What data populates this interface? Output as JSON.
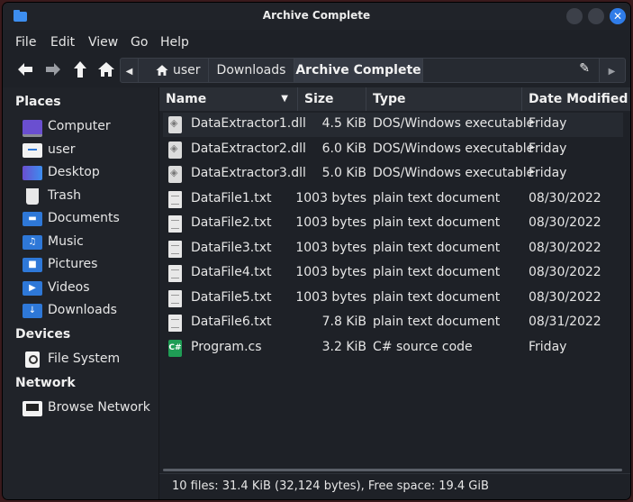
{
  "window": {
    "title": "Archive Complete"
  },
  "menu": [
    "File",
    "Edit",
    "View",
    "Go",
    "Help"
  ],
  "pathbar": {
    "crumbs": [
      "user",
      "Downloads",
      "Archive Complete"
    ]
  },
  "sidebar": {
    "places_title": "Places",
    "places": [
      {
        "label": "Computer",
        "icon": "computer-icon"
      },
      {
        "label": "user",
        "icon": "home-folder-icon"
      },
      {
        "label": "Desktop",
        "icon": "desktop-icon"
      },
      {
        "label": "Trash",
        "icon": "trash-icon"
      },
      {
        "label": "Documents",
        "icon": "documents-folder-icon"
      },
      {
        "label": "Music",
        "icon": "music-folder-icon"
      },
      {
        "label": "Pictures",
        "icon": "pictures-folder-icon"
      },
      {
        "label": "Videos",
        "icon": "videos-folder-icon"
      },
      {
        "label": "Downloads",
        "icon": "downloads-folder-icon"
      }
    ],
    "devices_title": "Devices",
    "devices": [
      {
        "label": "File System",
        "icon": "drive-icon"
      }
    ],
    "network_title": "Network",
    "network": [
      {
        "label": "Browse Network",
        "icon": "network-icon"
      }
    ]
  },
  "columns": {
    "name": "Name",
    "size": "Size",
    "type": "Type",
    "date": "Date Modified"
  },
  "files": [
    {
      "name": "DataExtractor1.dll",
      "size": "4.5 KiB",
      "type": "DOS/Windows executable",
      "date": "Friday",
      "kind": "dll"
    },
    {
      "name": "DataExtractor2.dll",
      "size": "6.0 KiB",
      "type": "DOS/Windows executable",
      "date": "Friday",
      "kind": "dll"
    },
    {
      "name": "DataExtractor3.dll",
      "size": "5.0 KiB",
      "type": "DOS/Windows executable",
      "date": "Friday",
      "kind": "dll"
    },
    {
      "name": "DataFile1.txt",
      "size": "1003 bytes",
      "type": "plain text document",
      "date": "08/30/2022",
      "kind": "txt"
    },
    {
      "name": "DataFile2.txt",
      "size": "1003 bytes",
      "type": "plain text document",
      "date": "08/30/2022",
      "kind": "txt"
    },
    {
      "name": "DataFile3.txt",
      "size": "1003 bytes",
      "type": "plain text document",
      "date": "08/30/2022",
      "kind": "txt"
    },
    {
      "name": "DataFile4.txt",
      "size": "1003 bytes",
      "type": "plain text document",
      "date": "08/30/2022",
      "kind": "txt"
    },
    {
      "name": "DataFile5.txt",
      "size": "1003 bytes",
      "type": "plain text document",
      "date": "08/30/2022",
      "kind": "txt"
    },
    {
      "name": "DataFile6.txt",
      "size": "7.8 KiB",
      "type": "plain text document",
      "date": "08/31/2022",
      "kind": "txt"
    },
    {
      "name": "Program.cs",
      "size": "3.2 KiB",
      "type": "C# source code",
      "date": "Friday",
      "kind": "cs"
    }
  ],
  "cs_icon_text": "C#",
  "status": "10 files: 31.4 KiB (32,124 bytes), Free space: 19.4 GiB",
  "colors": {
    "accent": "#2f7ce8",
    "folder": "#2e78d8",
    "background": "#1e2127"
  }
}
